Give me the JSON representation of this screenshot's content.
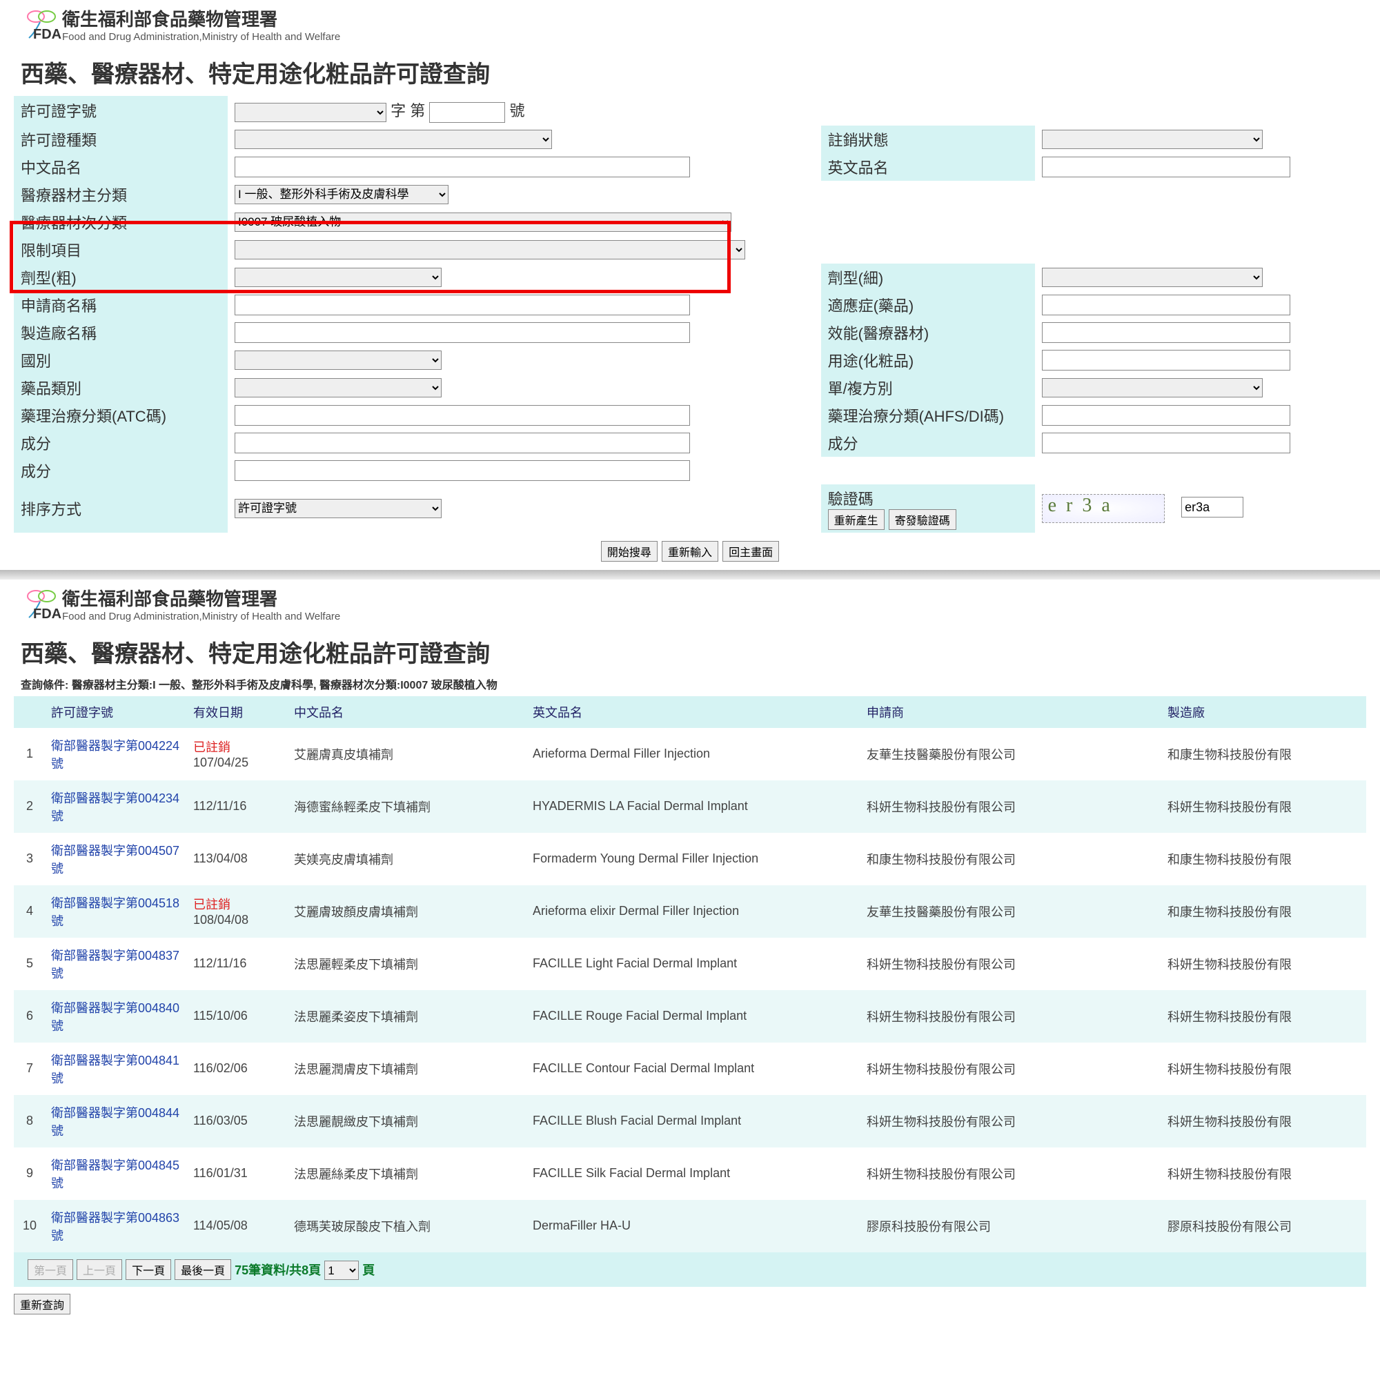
{
  "agency": {
    "cn": "衛生福利部食品藥物管理署",
    "en": "Food and Drug Administration,Ministry of Health and Welfare",
    "acronym": "FDA"
  },
  "page_title": "西藥、醫療器材、特定用途化粧品許可證查詢",
  "form": {
    "license_no": "許可證字號",
    "license_mid": "字 第",
    "license_suffix": "號",
    "license_type": "許可證種類",
    "revoke_status": "註銷狀態",
    "name_cn": "中文品名",
    "name_en": "英文品名",
    "device_main": "醫療器材主分類",
    "device_main_val": "I 一般、整形外科手術及皮膚科學",
    "device_sub": "醫療器材次分類",
    "device_sub_val": "I0007 玻尿酸植入物",
    "limit": "限制項目",
    "dosage_coarse": "劑型(粗)",
    "dosage_fine": "劑型(細)",
    "applicant": "申請商名稱",
    "indication": "適應症(藥品)",
    "manufacturer": "製造廠名稱",
    "efficacy": "效能(醫療器材)",
    "country": "國別",
    "usage": "用途(化粧品)",
    "drug_cat": "藥品類別",
    "recipe": "單/複方別",
    "atc": "藥理治療分類(ATC碼)",
    "ahfs": "藥理治療分類(AHFS/DI碼)",
    "ingredient": "成分",
    "ingredient2": "成分",
    "ingredient3": "成分",
    "sort": "排序方式",
    "sort_val": "許可證字號",
    "captcha_lbl": "驗證碼",
    "captcha_regen": "重新產生",
    "captcha_send": "寄發驗證碼",
    "captcha_text": "er3a",
    "captcha_input": "er3a",
    "btn_search": "開始搜尋",
    "btn_reset": "重新輸入",
    "btn_home": "回主畫面"
  },
  "result": {
    "cond": "查詢條件: 醫療器材主分類:I 一般、整形外科手術及皮膚科學, 醫療器材次分類:I0007 玻尿酸植入物",
    "cols": {
      "license": "許可證字號",
      "expiry": "有效日期",
      "cn": "中文品名",
      "en": "英文品名",
      "applicant": "申請商",
      "manufacturer": "製造廠"
    },
    "rows": [
      {
        "n": 1,
        "license": "衛部醫器製字第004224號",
        "revoked": "已註銷",
        "expiry": "107/04/25",
        "cn": "艾麗膚真皮填補劑",
        "en": "Arieforma Dermal Filler Injection",
        "applicant": "友華生技醫藥股份有限公司",
        "manufacturer": "和康生物科技股份有限"
      },
      {
        "n": 2,
        "license": "衛部醫器製字第004234號",
        "expiry": "112/11/16",
        "cn": "海德蜜絲輕柔皮下填補劑",
        "en": "HYADERMIS LA Facial Dermal Implant",
        "applicant": "科妍生物科技股份有限公司",
        "manufacturer": "科妍生物科技股份有限"
      },
      {
        "n": 3,
        "license": "衛部醫器製字第004507號",
        "expiry": "113/04/08",
        "cn": "芙媄亮皮膚填補劑",
        "en": "Formaderm Young Dermal Filler Injection",
        "applicant": "和康生物科技股份有限公司",
        "manufacturer": "和康生物科技股份有限"
      },
      {
        "n": 4,
        "license": "衛部醫器製字第004518號",
        "revoked": "已註銷",
        "expiry": "108/04/08",
        "cn": "艾麗膚玻顏皮膚填補劑",
        "en": "Arieforma elixir Dermal Filler Injection",
        "applicant": "友華生技醫藥股份有限公司",
        "manufacturer": "和康生物科技股份有限"
      },
      {
        "n": 5,
        "license": "衛部醫器製字第004837號",
        "expiry": "112/11/16",
        "cn": "法思麗輕柔皮下填補劑",
        "en": "FACILLE Light Facial Dermal Implant",
        "applicant": "科妍生物科技股份有限公司",
        "manufacturer": "科妍生物科技股份有限"
      },
      {
        "n": 6,
        "license": "衛部醫器製字第004840號",
        "expiry": "115/10/06",
        "cn": "法思麗柔姿皮下填補劑",
        "en": "FACILLE Rouge Facial Dermal Implant",
        "applicant": "科妍生物科技股份有限公司",
        "manufacturer": "科妍生物科技股份有限"
      },
      {
        "n": 7,
        "license": "衛部醫器製字第004841號",
        "expiry": "116/02/06",
        "cn": "法思麗潤膚皮下填補劑",
        "en": "FACILLE Contour Facial Dermal Implant",
        "applicant": "科妍生物科技股份有限公司",
        "manufacturer": "科妍生物科技股份有限"
      },
      {
        "n": 8,
        "license": "衛部醫器製字第004844號",
        "expiry": "116/03/05",
        "cn": "法思麗靚緻皮下填補劑",
        "en": "FACILLE Blush Facial Dermal Implant",
        "applicant": "科妍生物科技股份有限公司",
        "manufacturer": "科妍生物科技股份有限"
      },
      {
        "n": 9,
        "license": "衛部醫器製字第004845號",
        "expiry": "116/01/31",
        "cn": "法思麗絲柔皮下填補劑",
        "en": "FACILLE Silk Facial Dermal Implant",
        "applicant": "科妍生物科技股份有限公司",
        "manufacturer": "科妍生物科技股份有限"
      },
      {
        "n": 10,
        "license": "衛部醫器製字第004863號",
        "expiry": "114/05/08",
        "cn": "德瑪芙玻尿酸皮下植入劑",
        "en": "DermaFiller HA-U",
        "applicant": "膠原科技股份有限公司",
        "manufacturer": "膠原科技股份有限公司"
      }
    ],
    "pager": {
      "first": "第一頁",
      "prev": "上一頁",
      "next": "下一頁",
      "last": "最後一頁",
      "summary": "75筆資料/共8頁",
      "page_sel": "1",
      "page_suffix": "頁"
    },
    "requery": "重新查詢"
  }
}
